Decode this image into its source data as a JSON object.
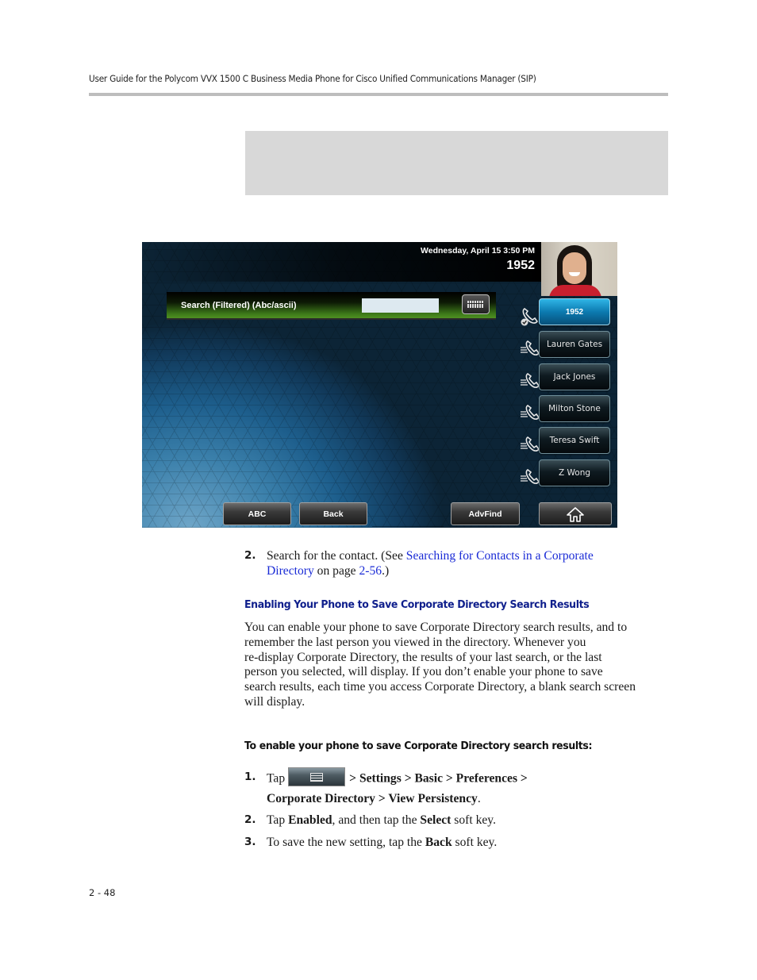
{
  "header": {
    "title": "User Guide for the Polycom VVX 1500 C Business Media Phone for Cisco Unified Communications Manager (SIP)"
  },
  "phone_screen": {
    "datetime": "Wednesday, April 15  3:50 PM",
    "extension": "1952",
    "search_bar": {
      "label": "Search (Filtered) (Abc/ascii)",
      "input_value": "",
      "keyboard_icon": "keyboard-icon"
    },
    "lines": [
      {
        "label": "1952",
        "active": true,
        "icon": "handset-registered-icon"
      },
      {
        "label": "Lauren Gates",
        "active": false,
        "icon": "speed-dial-handset-icon"
      },
      {
        "label": "Jack Jones",
        "active": false,
        "icon": "speed-dial-handset-icon"
      },
      {
        "label": "Milton Stone",
        "active": false,
        "icon": "speed-dial-handset-icon"
      },
      {
        "label": "Teresa Swift",
        "active": false,
        "icon": "speed-dial-handset-icon"
      },
      {
        "label": "Z Wong",
        "active": false,
        "icon": "speed-dial-handset-icon"
      }
    ],
    "softkeys": [
      "ABC",
      "Back",
      "",
      "AdvFind"
    ],
    "home_icon": "home-icon"
  },
  "step2_search": {
    "number": "2.",
    "text_before": "Search for the contact. (See ",
    "link1": "Searching for Contacts in a Corporate",
    "link1_cont": "Directory",
    "text_mid": " on page ",
    "link2": "2-56",
    "text_after": ".)"
  },
  "section": {
    "heading": "Enabling Your Phone to Save Corporate Directory Search Results",
    "paragraph_lines": [
      "You can enable your phone to save Corporate Directory search results, and to",
      "remember the last person you viewed in the directory. Whenever you",
      "re-display Corporate Directory, the results of your last search, or the last",
      "person you selected, will display. If you don’t enable your phone to save",
      "search results, each time you access Corporate Directory, a blank search screen",
      "will display."
    ]
  },
  "procedure": {
    "heading": "To enable your phone to save Corporate Directory search results:",
    "steps": [
      {
        "number": "1.",
        "tap": "Tap",
        "menu_icon": "menu-icon",
        "path_line1": "> Settings > Basic > Preferences >",
        "path_line2": "Corporate Directory > View Persistency",
        "end": "."
      },
      {
        "number": "2.",
        "parts": [
          "Tap ",
          "Enabled",
          ", and then tap the ",
          "Select",
          " soft key."
        ]
      },
      {
        "number": "3.",
        "parts": [
          "To save the new setting, tap the ",
          "Back",
          " soft key."
        ]
      }
    ]
  },
  "footer": {
    "page_number": "2 - 48"
  },
  "colors": {
    "link": "#1a2bd6",
    "heading_blue": "#0f1f8c",
    "active_line": "#0c7ab0",
    "search_bar_green": "#4f8f22"
  }
}
